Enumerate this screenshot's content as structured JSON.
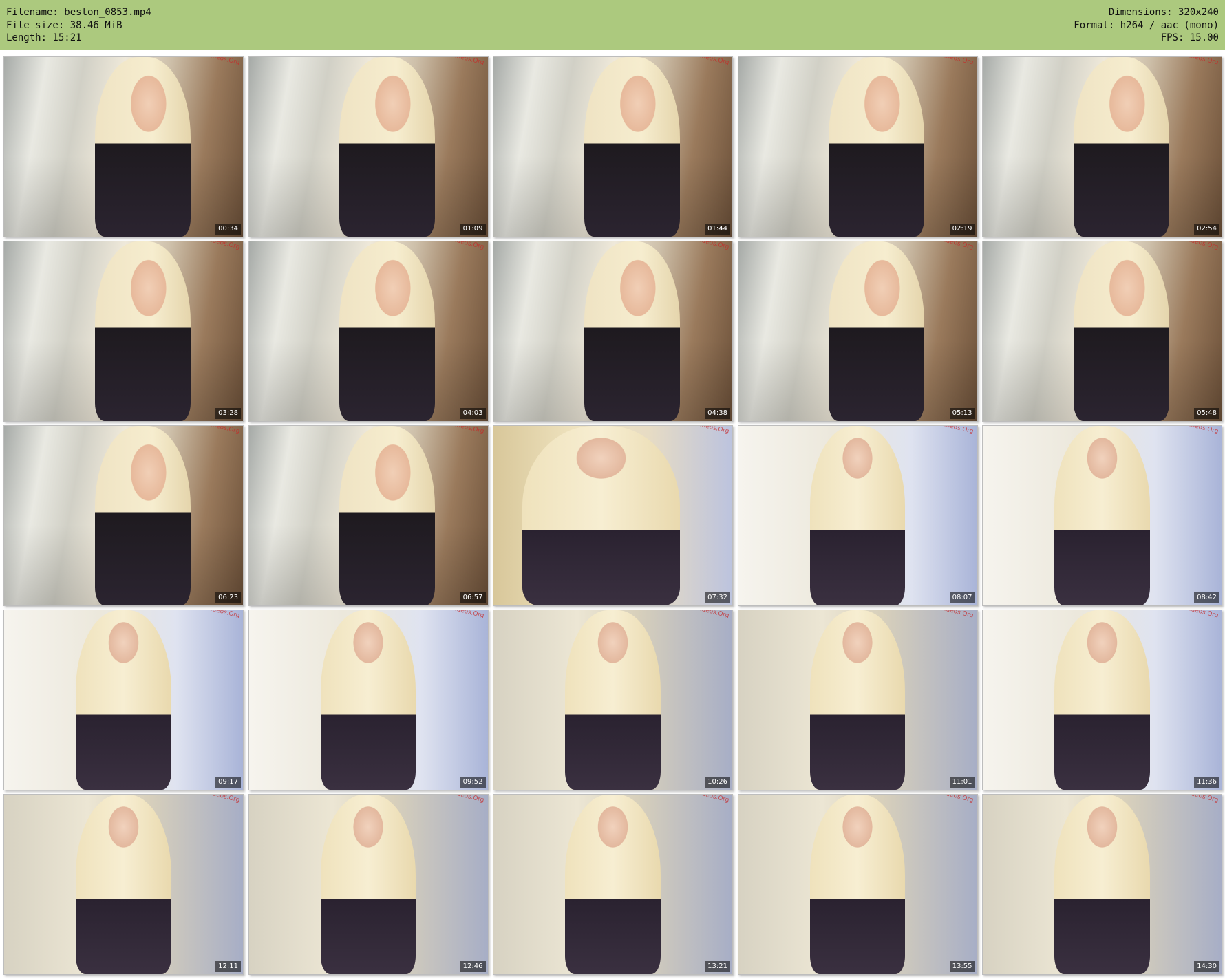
{
  "header": {
    "filename_line": "Filename: beston_0853.mp4",
    "filesize_line": "File size: 38.46 MiB",
    "length_line": "Length: 15:21",
    "dimensions_line": "Dimensions: 320x240",
    "format_line": "Format: h264 / aac (mono)",
    "fps_line": "FPS: 15.00",
    "background_color": "#acc97e"
  },
  "watermark_text": "CamGirlVideos.Org",
  "thumbnails": [
    {
      "time": "00:34",
      "scene": "room"
    },
    {
      "time": "01:09",
      "scene": "room"
    },
    {
      "time": "01:44",
      "scene": "room"
    },
    {
      "time": "02:19",
      "scene": "room"
    },
    {
      "time": "02:54",
      "scene": "room"
    },
    {
      "time": "03:28",
      "scene": "room"
    },
    {
      "time": "04:03",
      "scene": "room"
    },
    {
      "time": "04:38",
      "scene": "room"
    },
    {
      "time": "05:13",
      "scene": "room"
    },
    {
      "time": "05:48",
      "scene": "room"
    },
    {
      "time": "06:23",
      "scene": "room"
    },
    {
      "time": "06:57",
      "scene": "room"
    },
    {
      "time": "07:32",
      "scene": "close"
    },
    {
      "time": "08:07",
      "scene": "bright"
    },
    {
      "time": "08:42",
      "scene": "bright"
    },
    {
      "time": "09:17",
      "scene": "bright"
    },
    {
      "time": "09:52",
      "scene": "bright"
    },
    {
      "time": "10:26",
      "scene": "dim"
    },
    {
      "time": "11:01",
      "scene": "dim"
    },
    {
      "time": "11:36",
      "scene": "bright"
    },
    {
      "time": "12:11",
      "scene": "dim"
    },
    {
      "time": "12:46",
      "scene": "dim"
    },
    {
      "time": "13:21",
      "scene": "dim"
    },
    {
      "time": "13:55",
      "scene": "dim"
    },
    {
      "time": "14:30",
      "scene": "dim"
    }
  ]
}
